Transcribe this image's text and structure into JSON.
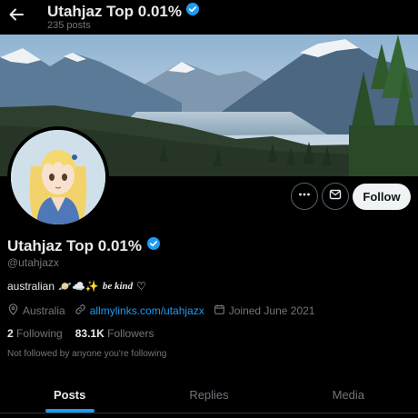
{
  "header": {
    "display_name": "Utahjaz Top 0.01%",
    "post_count": "235 posts"
  },
  "profile": {
    "display_name": "Utahjaz Top 0.01%",
    "handle": "@utahjazx",
    "bio_text": "australian",
    "bio_emojis": "🪐☁️✨",
    "bio_kind": "be kind",
    "bio_heart": "♡",
    "location": "Australia",
    "link": "allmylinks.com/utahjazx",
    "joined": "Joined June 2021",
    "following_count": "2",
    "following_label": "Following",
    "followers_count": "83.1K",
    "followers_label": "Followers",
    "not_followed_text": "Not followed by anyone you're following"
  },
  "actions": {
    "follow_label": "Follow"
  },
  "tabs": [
    {
      "label": "Posts",
      "active": true
    },
    {
      "label": "Replies",
      "active": false
    },
    {
      "label": "Media",
      "active": false
    }
  ],
  "colors": {
    "background": "#000000",
    "accent": "#1d9bf0",
    "verified": "#1d9bf0",
    "muted_text": "#71767b"
  },
  "icons": {
    "back": "arrow-left-icon",
    "verified": "verified-badge-icon",
    "more": "more-horizontal-icon",
    "message": "envelope-icon",
    "location": "location-pin-icon",
    "link": "link-icon",
    "calendar": "calendar-icon"
  }
}
